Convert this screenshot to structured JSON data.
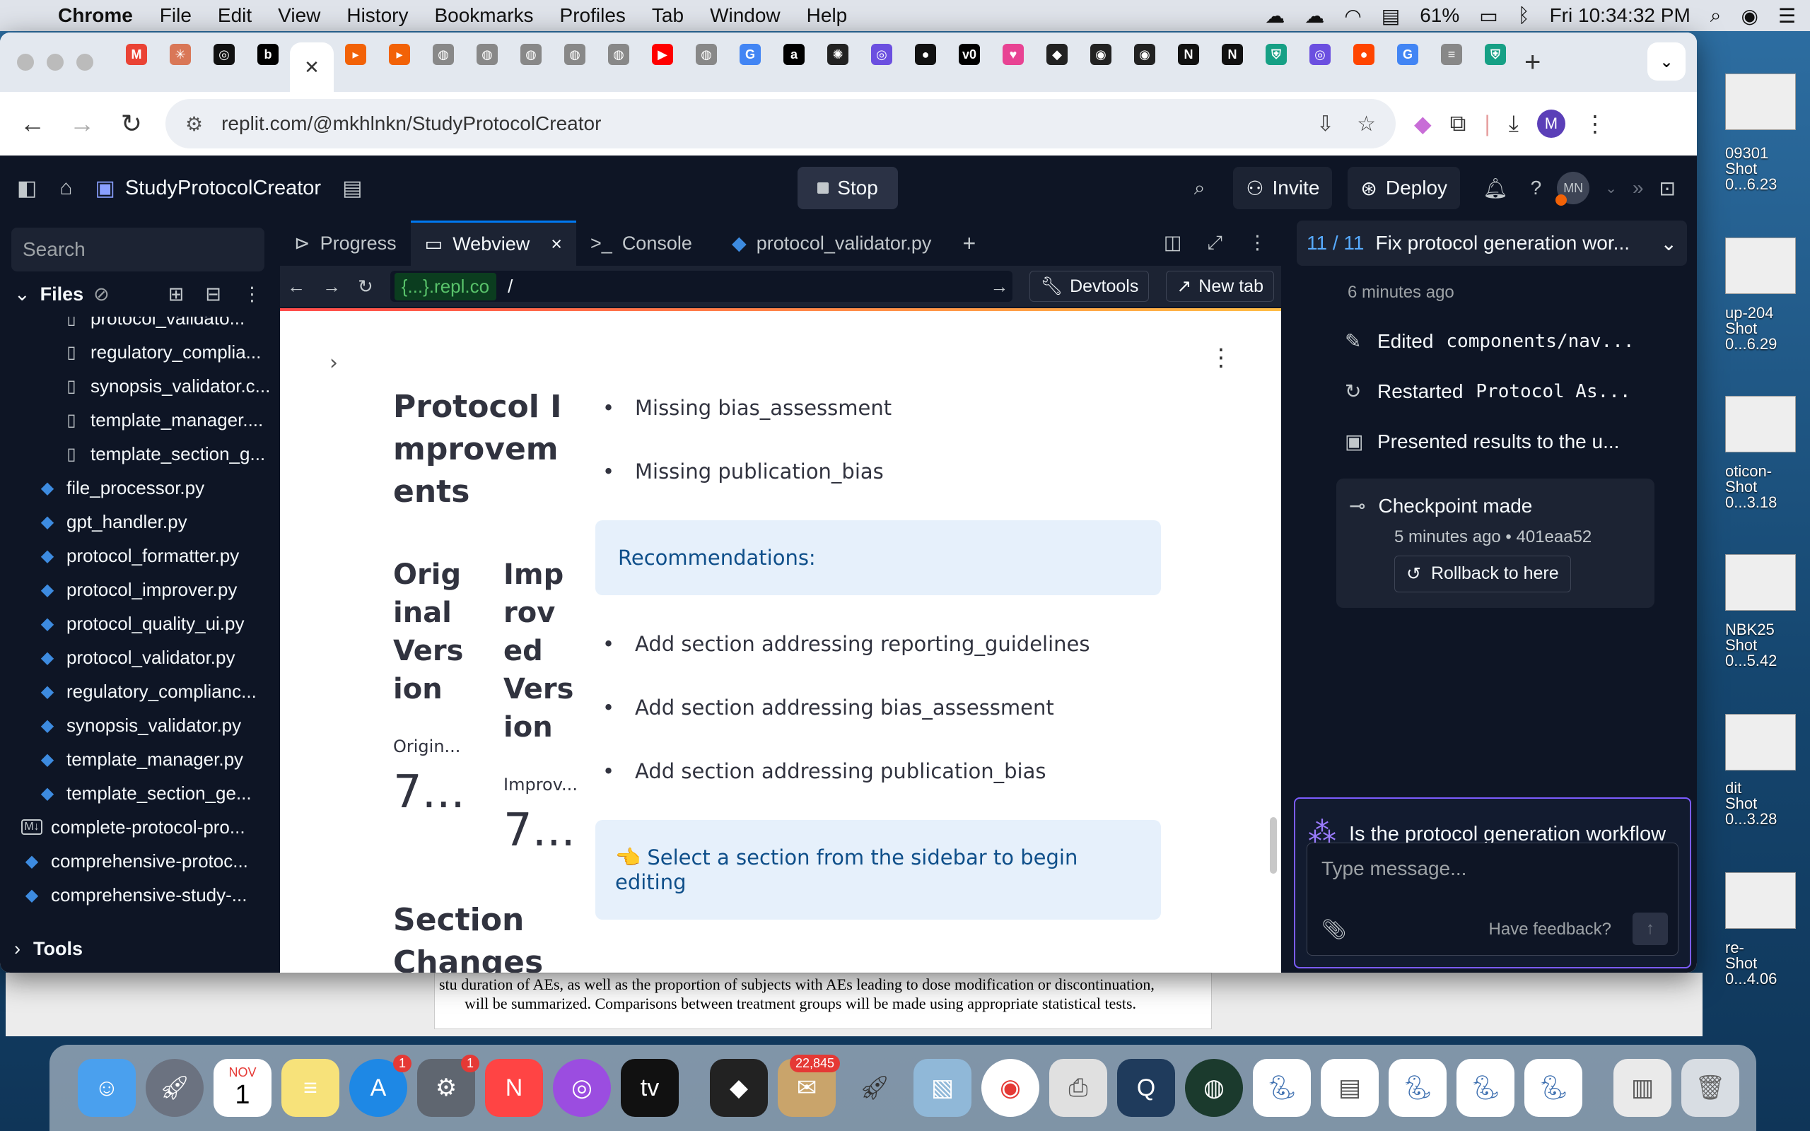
{
  "menubar": {
    "app": "Chrome",
    "items": [
      "File",
      "Edit",
      "View",
      "History",
      "Bookmarks",
      "Profiles",
      "Tab",
      "Window",
      "Help"
    ],
    "battery": "61%",
    "clock": "Fri 10:34:32 PM"
  },
  "browser": {
    "url": "replit.com/@mkhlnkn/StudyProtocolCreator",
    "profile_initial": "M",
    "tabs_favicons": [
      "gmail",
      "claude",
      "chatgpt",
      "bold-b",
      "replit-active",
      "replit",
      "replit",
      "globe",
      "globe",
      "globe",
      "globe",
      "globe",
      "youtube",
      "globe",
      "google",
      "amazon",
      "perplexity",
      "openai",
      "github",
      "v0",
      "lovable",
      "cursor",
      "circle",
      "circle",
      "notion",
      "notion",
      "shield",
      "openai",
      "reddit",
      "google",
      "elsevier",
      "shield"
    ]
  },
  "replit": {
    "project_name": "StudyProtocolCreator",
    "stop_label": "Stop",
    "invite_label": "Invite",
    "deploy_label": "Deploy",
    "user_initials": "MN",
    "search_placeholder": "Search",
    "files_label": "Files",
    "tools_label": "Tools",
    "files": [
      {
        "name": "protocol_validato...",
        "type": "doc",
        "indent": 2
      },
      {
        "name": "regulatory_complia...",
        "type": "doc",
        "indent": 2
      },
      {
        "name": "synopsis_validator.c...",
        "type": "doc",
        "indent": 2
      },
      {
        "name": "template_manager....",
        "type": "doc",
        "indent": 2
      },
      {
        "name": "template_section_g...",
        "type": "doc",
        "indent": 2
      },
      {
        "name": "file_processor.py",
        "type": "py",
        "indent": 1
      },
      {
        "name": "gpt_handler.py",
        "type": "py",
        "indent": 1
      },
      {
        "name": "protocol_formatter.py",
        "type": "py",
        "indent": 1
      },
      {
        "name": "protocol_improver.py",
        "type": "py",
        "indent": 1
      },
      {
        "name": "protocol_quality_ui.py",
        "type": "py",
        "indent": 1
      },
      {
        "name": "protocol_validator.py",
        "type": "py",
        "indent": 1
      },
      {
        "name": "regulatory_complianc...",
        "type": "py",
        "indent": 1
      },
      {
        "name": "synopsis_validator.py",
        "type": "py",
        "indent": 1
      },
      {
        "name": "template_manager.py",
        "type": "py",
        "indent": 1
      },
      {
        "name": "template_section_ge...",
        "type": "py",
        "indent": 1
      },
      {
        "name": "complete-protocol-pro...",
        "type": "md",
        "indent": 0
      },
      {
        "name": "comprehensive-protoc...",
        "type": "py",
        "indent": 0
      },
      {
        "name": "comprehensive-study-...",
        "type": "py",
        "indent": 0
      }
    ],
    "tabs": [
      {
        "label": "Progress",
        "icon": "⊳"
      },
      {
        "label": "Webview",
        "icon": "▭"
      },
      {
        "label": "Console",
        "icon": ">_"
      },
      {
        "label": "protocol_validator.py",
        "icon": "py"
      }
    ],
    "webview": {
      "repl_tag": "{...}.repl.co",
      "path": "/",
      "devtools_label": "Devtools",
      "newtab_label": "New tab"
    }
  },
  "app_content": {
    "heading": "Protocol Improvements",
    "original_label": "Original Version",
    "improved_label": "Improved Version",
    "original_sub": "Origin...",
    "improved_sub": "Improv...",
    "original_value": "7...",
    "improved_value": "7...",
    "section_changes": "Section Changes",
    "missing": [
      "Missing bias_assessment",
      "Missing publication_bias"
    ],
    "recommendations_title": "Recommendations:",
    "recommendations": [
      "Add section addressing reporting_guidelines",
      "Add section addressing bias_assessment",
      "Add section addressing publication_bias"
    ],
    "cta": "👈 Select a section from the sidebar to begin editing"
  },
  "agent": {
    "counter": "11 / 11",
    "title": "Fix protocol generation wor...",
    "time_ago": "6 minutes ago",
    "actions": [
      {
        "icon": "edit-icon",
        "prefix": "Edited ",
        "mono": "components/nav..."
      },
      {
        "icon": "restart-icon",
        "prefix": "Restarted ",
        "mono": "Protocol As..."
      },
      {
        "icon": "present-icon",
        "prefix": "Presented results to the u...",
        "mono": ""
      }
    ],
    "checkpoint_title": "Checkpoint made",
    "checkpoint_meta": "5 minutes ago • 401eaa52",
    "rollback_label": "Rollback to here",
    "question": "Is the protocol generation workflow now working correctly with proper validation scores, progress tracking, and before/after comparisons?",
    "message_placeholder": "Type message...",
    "feedback_label": "Have feedback?"
  },
  "background_doc": {
    "fragment_prefix": "stu",
    "line1": "duration of AEs, as well as the proportion of subjects with AEs leading to dose modification or discontinuation,",
    "line2": "will be summarized. Comparisons between treatment groups will be made using appropriate statistical tests."
  },
  "desktop_labels": [
    "09301",
    "Shot",
    "0...6.23",
    "up-204",
    "Shot",
    "0...6.29",
    "oticon-",
    "Shot",
    "0...3.18",
    "NBK25",
    "Shot",
    "0...5.42",
    "dit",
    "Shot",
    "0...3.28",
    "re-",
    "Shot",
    "0...4.06"
  ],
  "dock": {
    "badges": {
      "appstore": "1",
      "settings": "1",
      "mail": "22,845"
    },
    "calendar_month": "NOV",
    "calendar_day": "1",
    "appletv": "tv"
  }
}
